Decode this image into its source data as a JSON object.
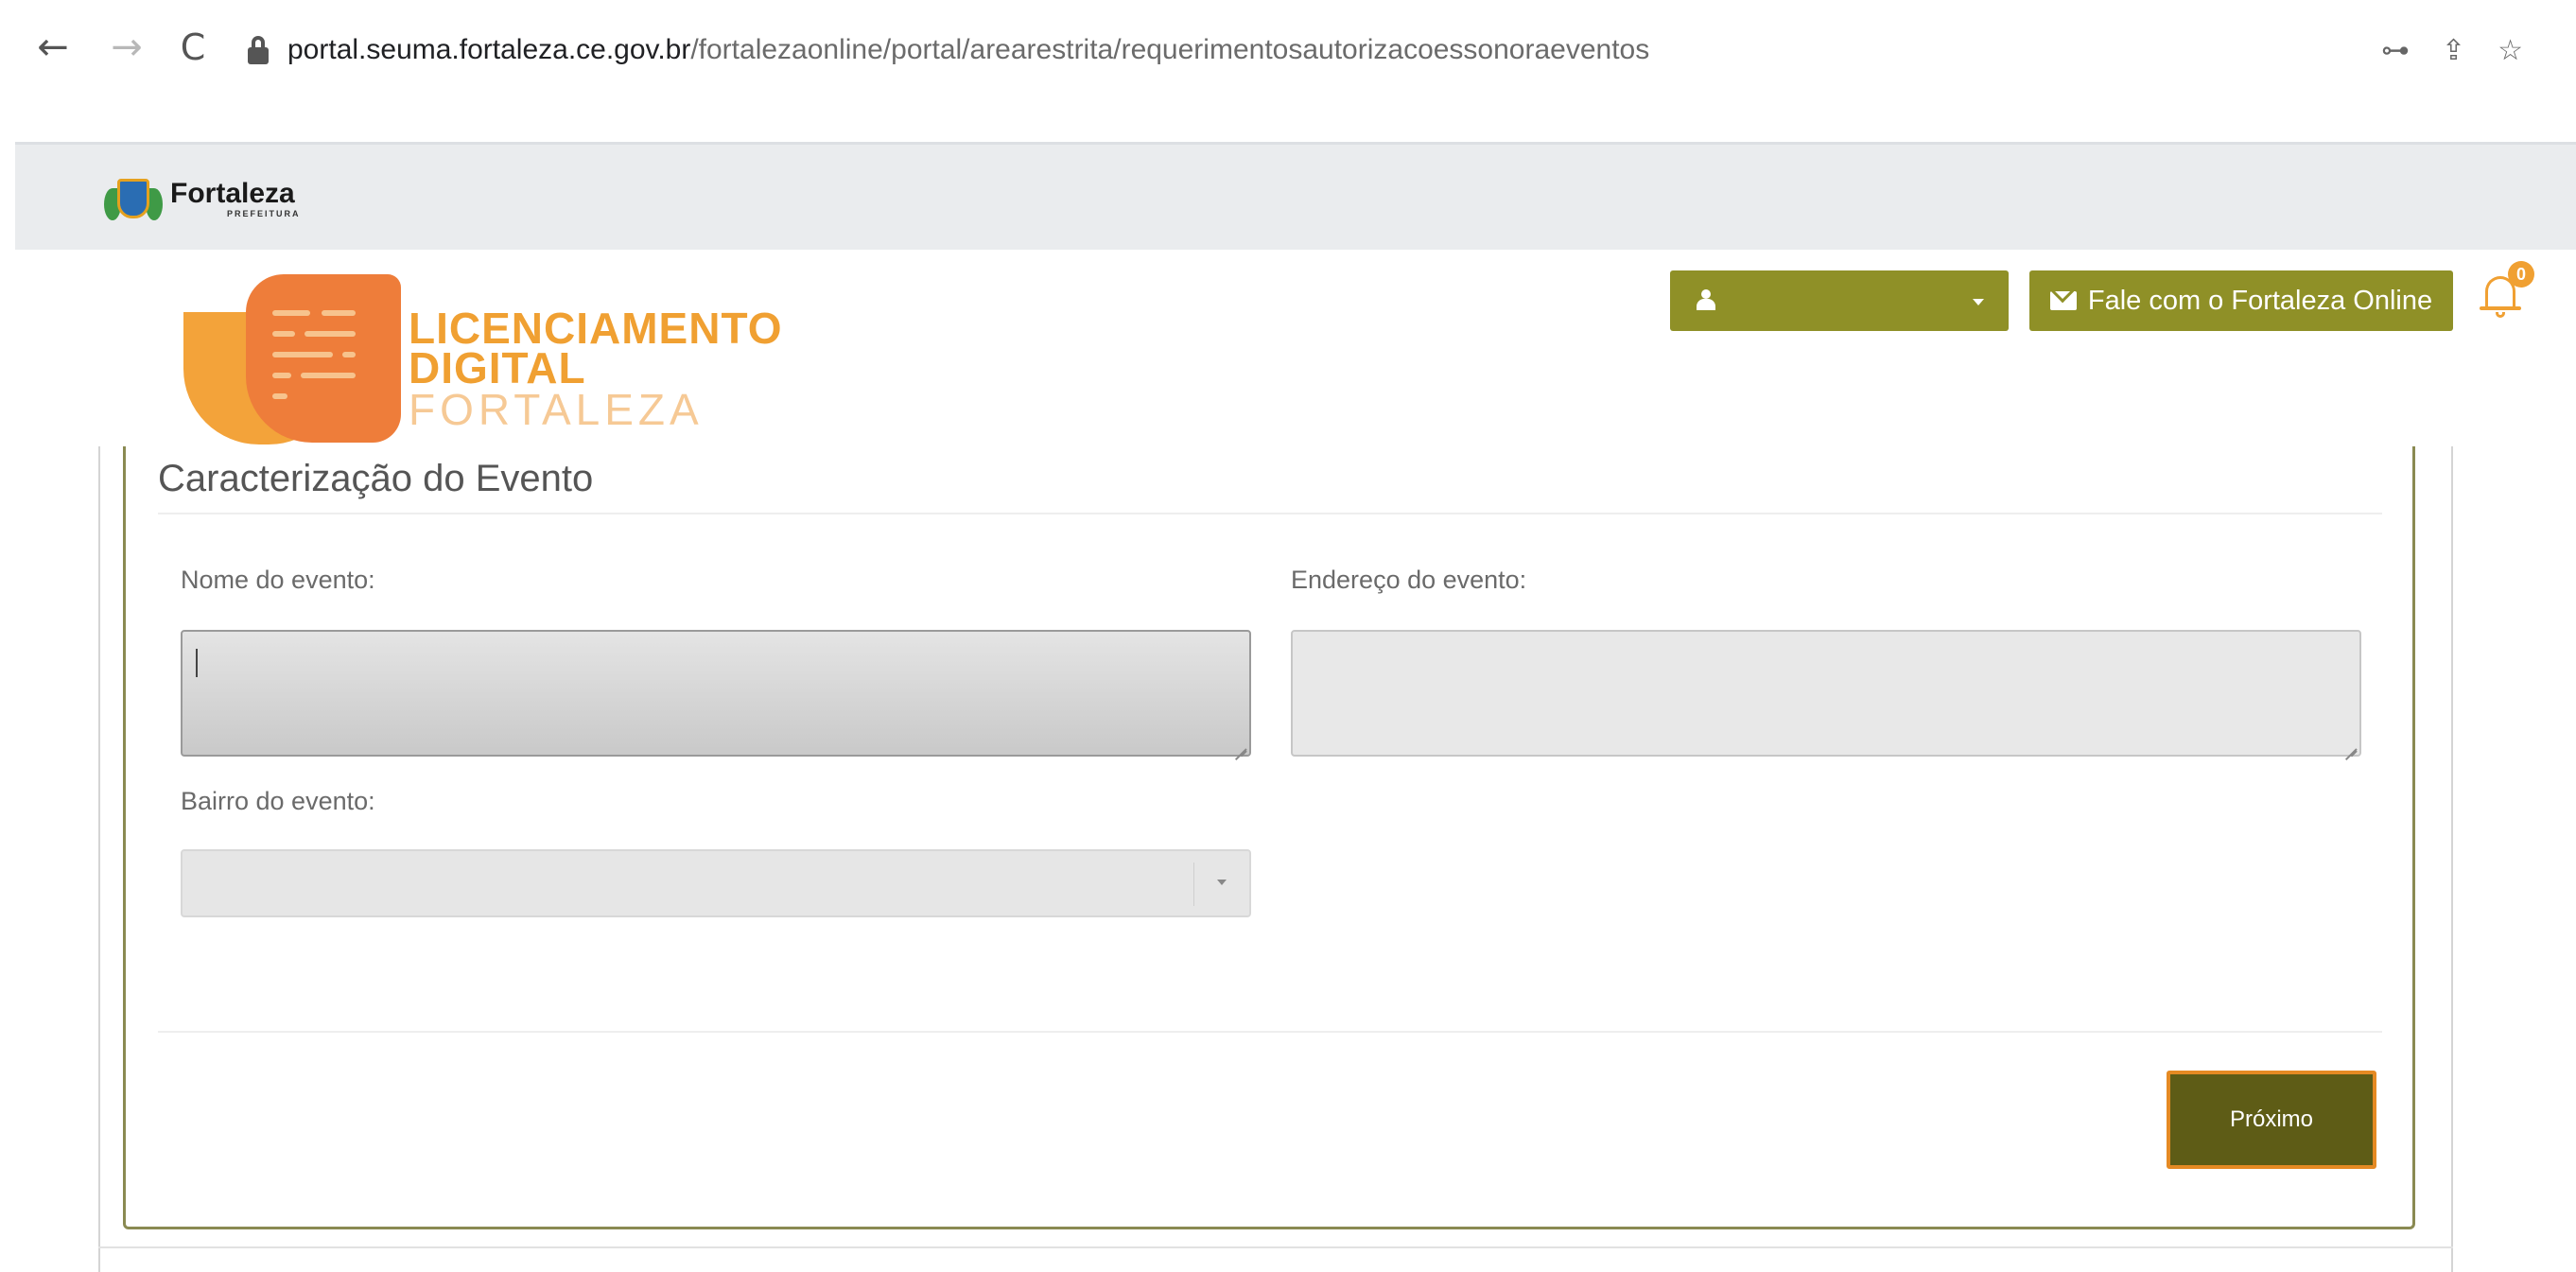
{
  "browser": {
    "back_icon": "←",
    "forward_icon": "→",
    "reload_icon": "C",
    "url_host": "portal.seuma.fortaleza.ce.gov.br",
    "url_path": "/fortalezaonline/portal/arearestrita/requerimentosautorizacoessonoraeventos",
    "key_icon": "⊶",
    "share_icon": "⇪",
    "star_icon": "☆"
  },
  "portal": {
    "brand_name": "Fortaleza",
    "brand_sub": "PREFEITURA"
  },
  "header": {
    "logo_line1": "LICENCIAMENTO",
    "logo_line2": "DIGITAL",
    "logo_line3": "FORTALEZA",
    "user_button_label": "",
    "contact_button_label": "Fale com o Fortaleza Online",
    "notification_count": "0"
  },
  "form": {
    "section_title": "Caracterização do Evento",
    "nome_label": "Nome do evento:",
    "nome_value": "",
    "endereco_label": "Endereço do evento:",
    "endereco_value": "",
    "bairro_label": "Bairro do evento:",
    "bairro_value": "",
    "next_button_label": "Próximo"
  },
  "colors": {
    "olive_button": "#8f9027",
    "next_button": "#5e5c16",
    "next_border": "#e58a23",
    "logo_orange": "#f0a032"
  }
}
